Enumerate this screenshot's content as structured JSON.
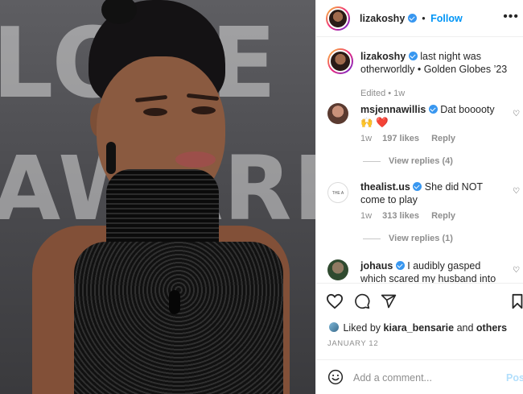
{
  "media": {
    "background_text_line1": "LOBE",
    "background_text_line2": "AWARDS"
  },
  "header": {
    "username": "lizakoshy",
    "separator": "•",
    "follow_label": "Follow",
    "more_label": "•••"
  },
  "caption": {
    "username": "lizakoshy",
    "text": "last night was otherworldly • Golden Globes ’23",
    "edited": "Edited • 1w"
  },
  "comments": [
    {
      "username": "msjennawillis",
      "text": "Dat booooty 🙌 ❤️",
      "age": "1w",
      "likes": "197 likes",
      "reply": "Reply",
      "view_replies": "View replies (4)"
    },
    {
      "username": "thealist.us",
      "text": "She did NOT come to play",
      "age": "1w",
      "likes": "313 likes",
      "reply": "Reply",
      "view_replies": "View replies (1)",
      "avatar_text": "THE A LIST"
    },
    {
      "username": "johaus",
      "text": "I audibly gasped which scared my husband into asking"
    }
  ],
  "likes": {
    "prefix": "Liked by",
    "user": "kiara_bensarie",
    "and": "and",
    "others": "others"
  },
  "date": "JANUARY 12",
  "composer": {
    "placeholder": "Add a comment...",
    "post_label": "Post"
  },
  "colors": {
    "accent": "#0095f6",
    "verified": "#3897f0",
    "muted": "#8e8e8e"
  }
}
